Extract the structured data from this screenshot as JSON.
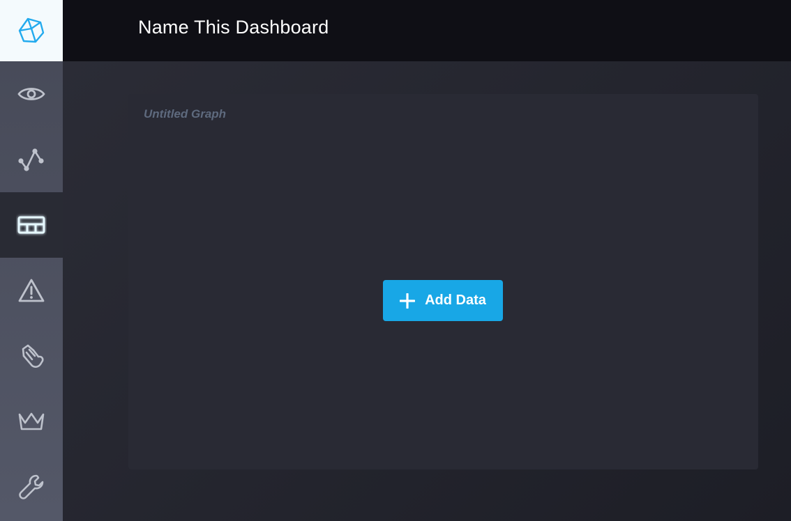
{
  "header": {
    "title": "Name This Dashboard"
  },
  "sidebar": {
    "logo_icon": "influxdb-cube-logo",
    "accent_color": "#22aaee",
    "items": [
      {
        "id": "data-explorer",
        "icon": "eye-icon",
        "active": false
      },
      {
        "id": "metrics",
        "icon": "graph-line-icon",
        "active": false
      },
      {
        "id": "dashboards",
        "icon": "dashboard-grid-icon",
        "active": true
      },
      {
        "id": "alerts",
        "icon": "alert-triangle-icon",
        "active": false
      },
      {
        "id": "logs",
        "icon": "log-hand-icon",
        "active": false
      },
      {
        "id": "admin",
        "icon": "crown-icon",
        "active": false
      },
      {
        "id": "config",
        "icon": "wrench-icon",
        "active": false
      }
    ]
  },
  "main": {
    "cell": {
      "title": "Untitled Graph",
      "add_data_label": "Add Data",
      "add_data_color": "#18a7e6"
    }
  }
}
